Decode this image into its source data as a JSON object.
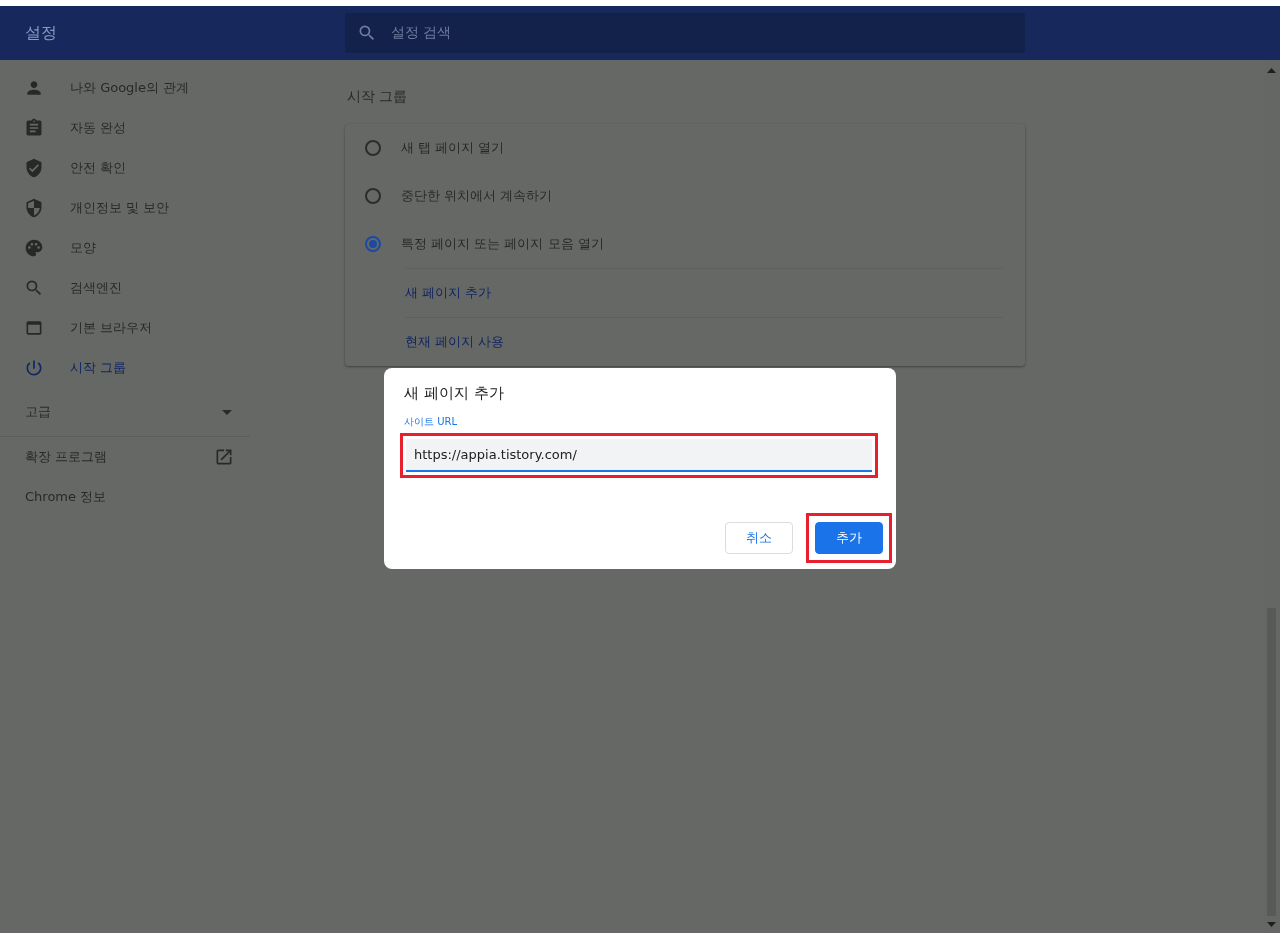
{
  "header": {
    "title": "설정",
    "search": {
      "placeholder": "설정 검색"
    }
  },
  "sidebar": {
    "items": [
      {
        "label": "나와 Google의 관계",
        "selected": false
      },
      {
        "label": "자동 완성",
        "selected": false
      },
      {
        "label": "안전 확인",
        "selected": false
      },
      {
        "label": "개인정보 및 보안",
        "selected": false
      },
      {
        "label": "모양",
        "selected": false
      },
      {
        "label": "검색엔진",
        "selected": false
      },
      {
        "label": "기본 브라우저",
        "selected": false
      },
      {
        "label": "시작 그룹",
        "selected": true
      }
    ],
    "advanced": {
      "label": "고급",
      "expanded": false
    },
    "links": [
      {
        "label": "확장 프로그램",
        "kind": "external"
      },
      {
        "label": "Chrome 정보",
        "kind": "plain"
      }
    ]
  },
  "section": {
    "title": "시작 그룹",
    "options": [
      {
        "label": "새 탭 페이지 열기",
        "selected": false
      },
      {
        "label": "중단한 위치에서 계속하기",
        "selected": false
      },
      {
        "label": "특정 페이지 또는 페이지 모음 열기",
        "selected": true
      }
    ],
    "actions": [
      "새 페이지 추가",
      "현재 페이지 사용"
    ]
  },
  "dialog": {
    "title": "새 페이지 추가",
    "field": {
      "label": "사이트 URL",
      "value": "https://appia.tistory.com/",
      "highlighted": true
    },
    "buttons": [
      {
        "label": "취소",
        "kind": "secondary",
        "highlighted": false
      },
      {
        "label": "추가",
        "kind": "primary",
        "highlighted": true
      }
    ]
  }
}
